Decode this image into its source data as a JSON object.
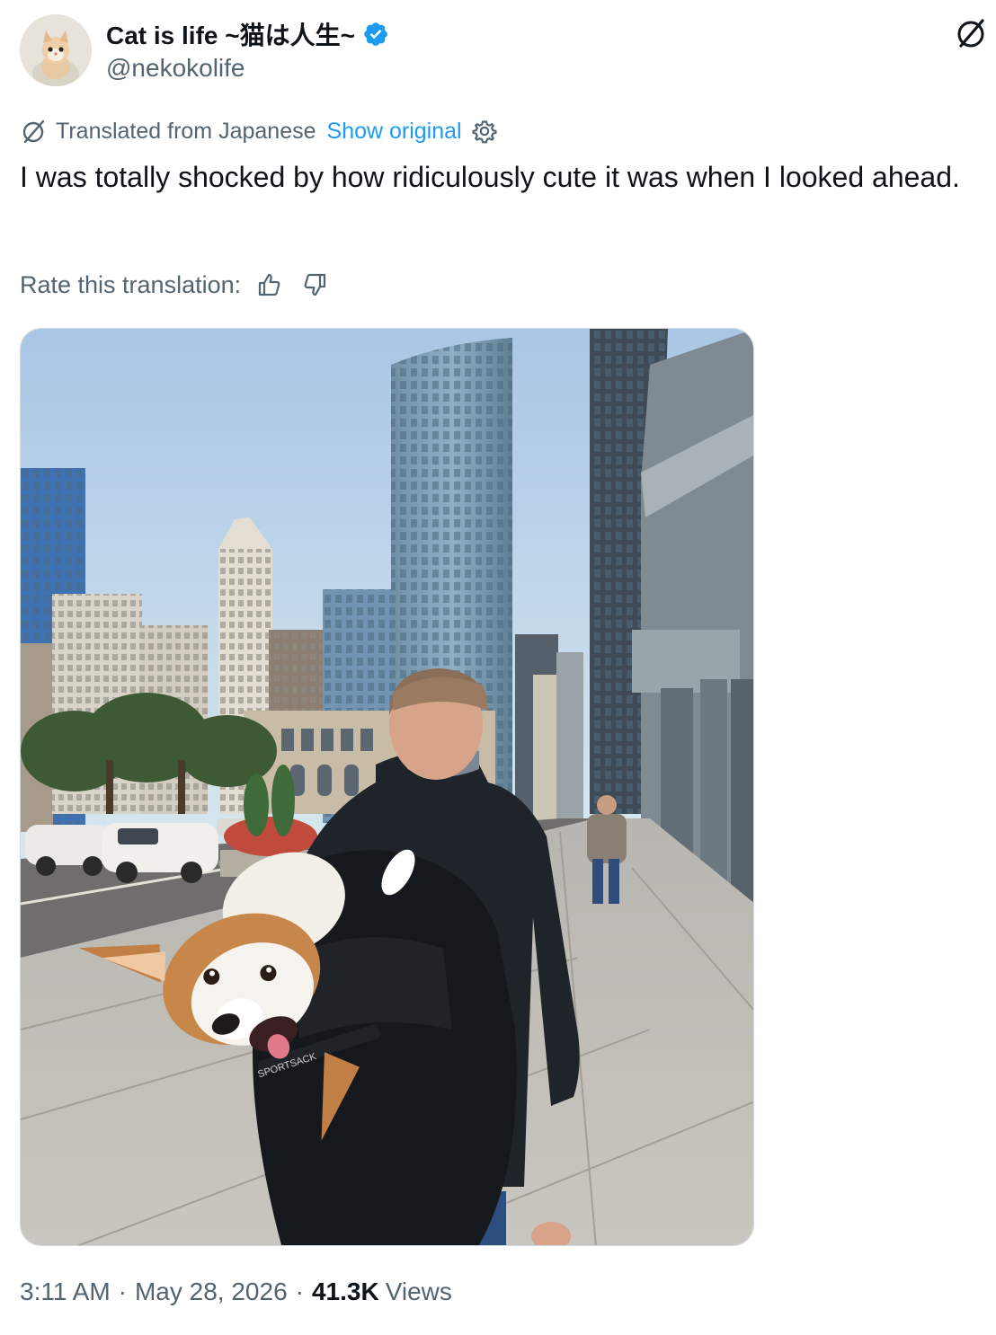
{
  "author": {
    "display_name": "Cat is life ~猫は人生~",
    "handle": "@nekokolife",
    "verified": true,
    "avatar_icon": "kitten-avatar"
  },
  "header": {
    "grok_icon": "grok-slash-icon"
  },
  "translation": {
    "label": "Translated from Japanese",
    "show_original": "Show original",
    "settings_icon": "gear-icon"
  },
  "tweet": {
    "text": "I was totally shocked by how ridiculously cute it was when I looked ahead."
  },
  "rating": {
    "label": "Rate this translation:",
    "up_icon": "thumbs-up-icon",
    "down_icon": "thumbs-down-icon"
  },
  "media": {
    "type": "photo",
    "bag_label": "SPORTSACK"
  },
  "meta": {
    "time": "3:11 AM",
    "date": "May 28, 2026",
    "views_count": "41.3K",
    "views_label": "Views",
    "separator": "·"
  },
  "colors": {
    "link": "#1d9bf0",
    "secondary_text": "#536471",
    "primary_text": "#0f1419",
    "verified": "#1d9bf0"
  }
}
